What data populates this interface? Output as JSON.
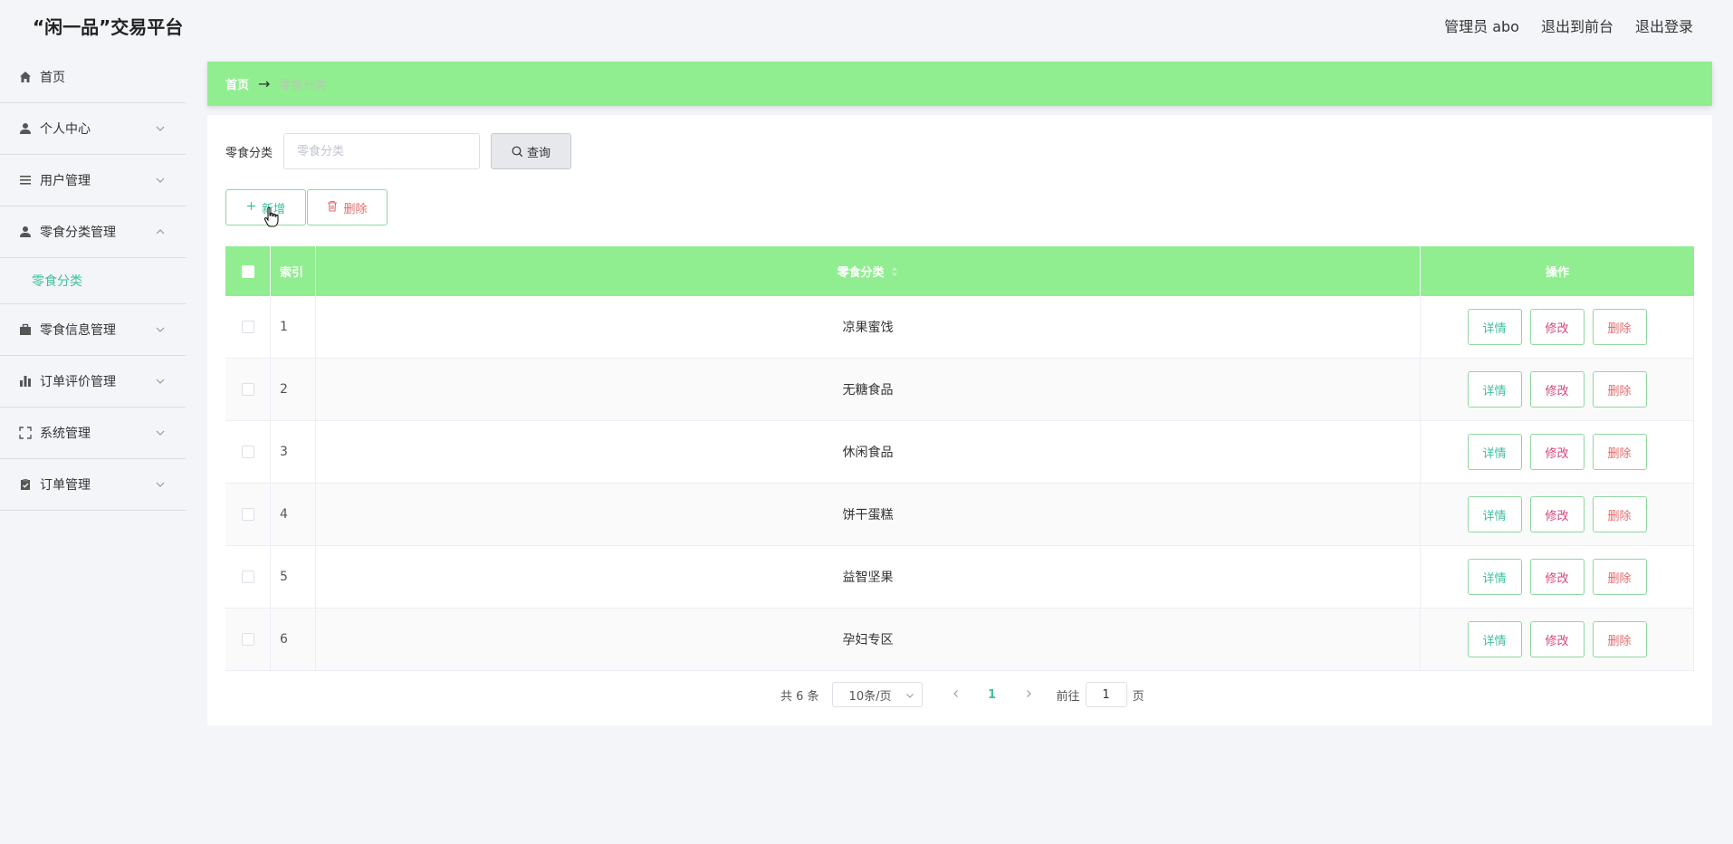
{
  "header": {
    "brand": "“闲一品”交易平台",
    "admin_label": "管理员 abo",
    "back_front": "退出到前台",
    "logout": "退出登录"
  },
  "sidebar": {
    "items": [
      {
        "label": "首页",
        "icon": "home-icon"
      },
      {
        "label": "个人中心",
        "icon": "user-icon"
      },
      {
        "label": "用户管理",
        "icon": "list-icon"
      },
      {
        "label": "零食分类管理",
        "icon": "user-icon"
      },
      {
        "label": "零食信息管理",
        "icon": "briefcase-icon"
      },
      {
        "label": "订单评价管理",
        "icon": "bar-chart-icon"
      },
      {
        "label": "系统管理",
        "icon": "fullscreen-icon"
      },
      {
        "label": "订单管理",
        "icon": "clipboard-icon"
      }
    ],
    "active_sub": "零食分类"
  },
  "breadcrumb": {
    "home": "首页",
    "arrow": "→",
    "current": "零食分类"
  },
  "search": {
    "label": "零食分类",
    "placeholder": "零食分类",
    "value": "",
    "query_label": "查询"
  },
  "actions": {
    "add_label": "新增",
    "delete_label": "删除"
  },
  "table": {
    "headers": {
      "index": "索引",
      "name": "零食分类",
      "ops": "操作"
    },
    "rows": [
      {
        "index": "1",
        "name": "凉果蜜饯"
      },
      {
        "index": "2",
        "name": "无糖食品"
      },
      {
        "index": "3",
        "name": "休闲食品"
      },
      {
        "index": "4",
        "name": "饼干蛋糕"
      },
      {
        "index": "5",
        "name": "益智坚果"
      },
      {
        "index": "6",
        "name": "孕妇专区"
      }
    ],
    "op_labels": {
      "detail": "详情",
      "edit": "修改",
      "delete": "删除"
    }
  },
  "pagination": {
    "total": "共 6 条",
    "page_size": "10条/页",
    "current_page": "1",
    "goto_prefix": "前往",
    "goto_value": "1",
    "goto_suffix": "页"
  },
  "colors": {
    "accent_green": "#90ee90",
    "teal": "#3dbfa0",
    "danger": "#e46b6b",
    "pink": "#d6457c"
  }
}
